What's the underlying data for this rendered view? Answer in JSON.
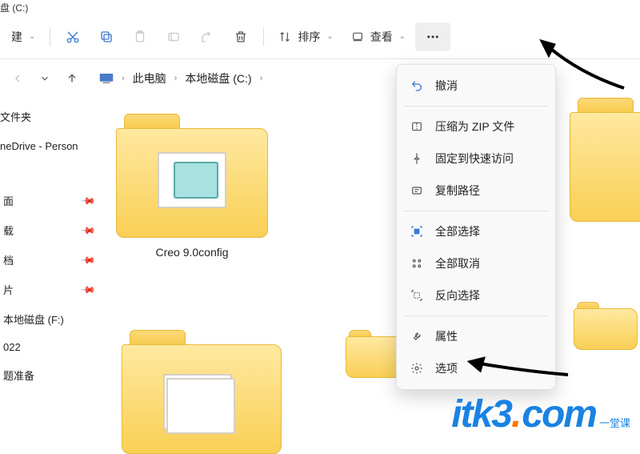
{
  "title": "盘 (C:)",
  "toolbar": {
    "new_label": "建",
    "sort": "排序",
    "view": "查看"
  },
  "breadcrumb": {
    "pc": "此电脑",
    "drive": "本地磁盘 (C:)"
  },
  "sidebar": {
    "header": "文件夹",
    "onedrive": "neDrive - Person",
    "items": [
      {
        "label": "面"
      },
      {
        "label": "载"
      },
      {
        "label": "档"
      },
      {
        "label": "片"
      },
      {
        "label": "本地磁盘 (F:)"
      },
      {
        "label": "022"
      },
      {
        "label": "题准备"
      }
    ]
  },
  "folders": {
    "f1": "Creo 9.0config"
  },
  "menu": {
    "undo": "撤消",
    "zip": "压缩为 ZIP 文件",
    "pin": "固定到快速访问",
    "copy_path": "复制路径",
    "select_all": "全部选择",
    "deselect": "全部取消",
    "invert": "反向选择",
    "properties": "属性",
    "options": "选项"
  },
  "watermark": {
    "a": "itk3",
    "b": ".",
    "c": "com",
    "d1": "一堂课",
    "d2": ""
  }
}
